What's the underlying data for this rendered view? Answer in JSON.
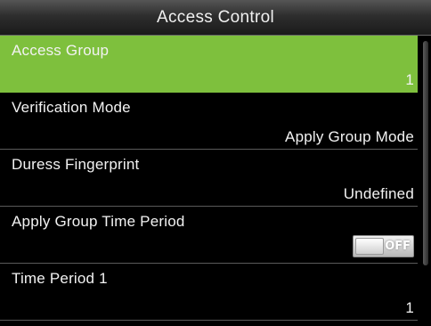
{
  "header": {
    "title": "Access Control"
  },
  "menu": [
    {
      "label": "Access Group",
      "value": "1",
      "selected": true
    },
    {
      "label": "Verification Mode",
      "value": "Apply Group Mode"
    },
    {
      "label": "Duress Fingerprint",
      "value": "Undefined"
    },
    {
      "label": "Apply Group Time Period",
      "toggle": "OFF"
    },
    {
      "label": "Time Period 1",
      "value": "1"
    }
  ],
  "colors": {
    "selected_row": "#7ec03d",
    "background": "#000000",
    "text": "#ffffff"
  },
  "icons": {
    "toggle": "toggle-switch-off"
  }
}
